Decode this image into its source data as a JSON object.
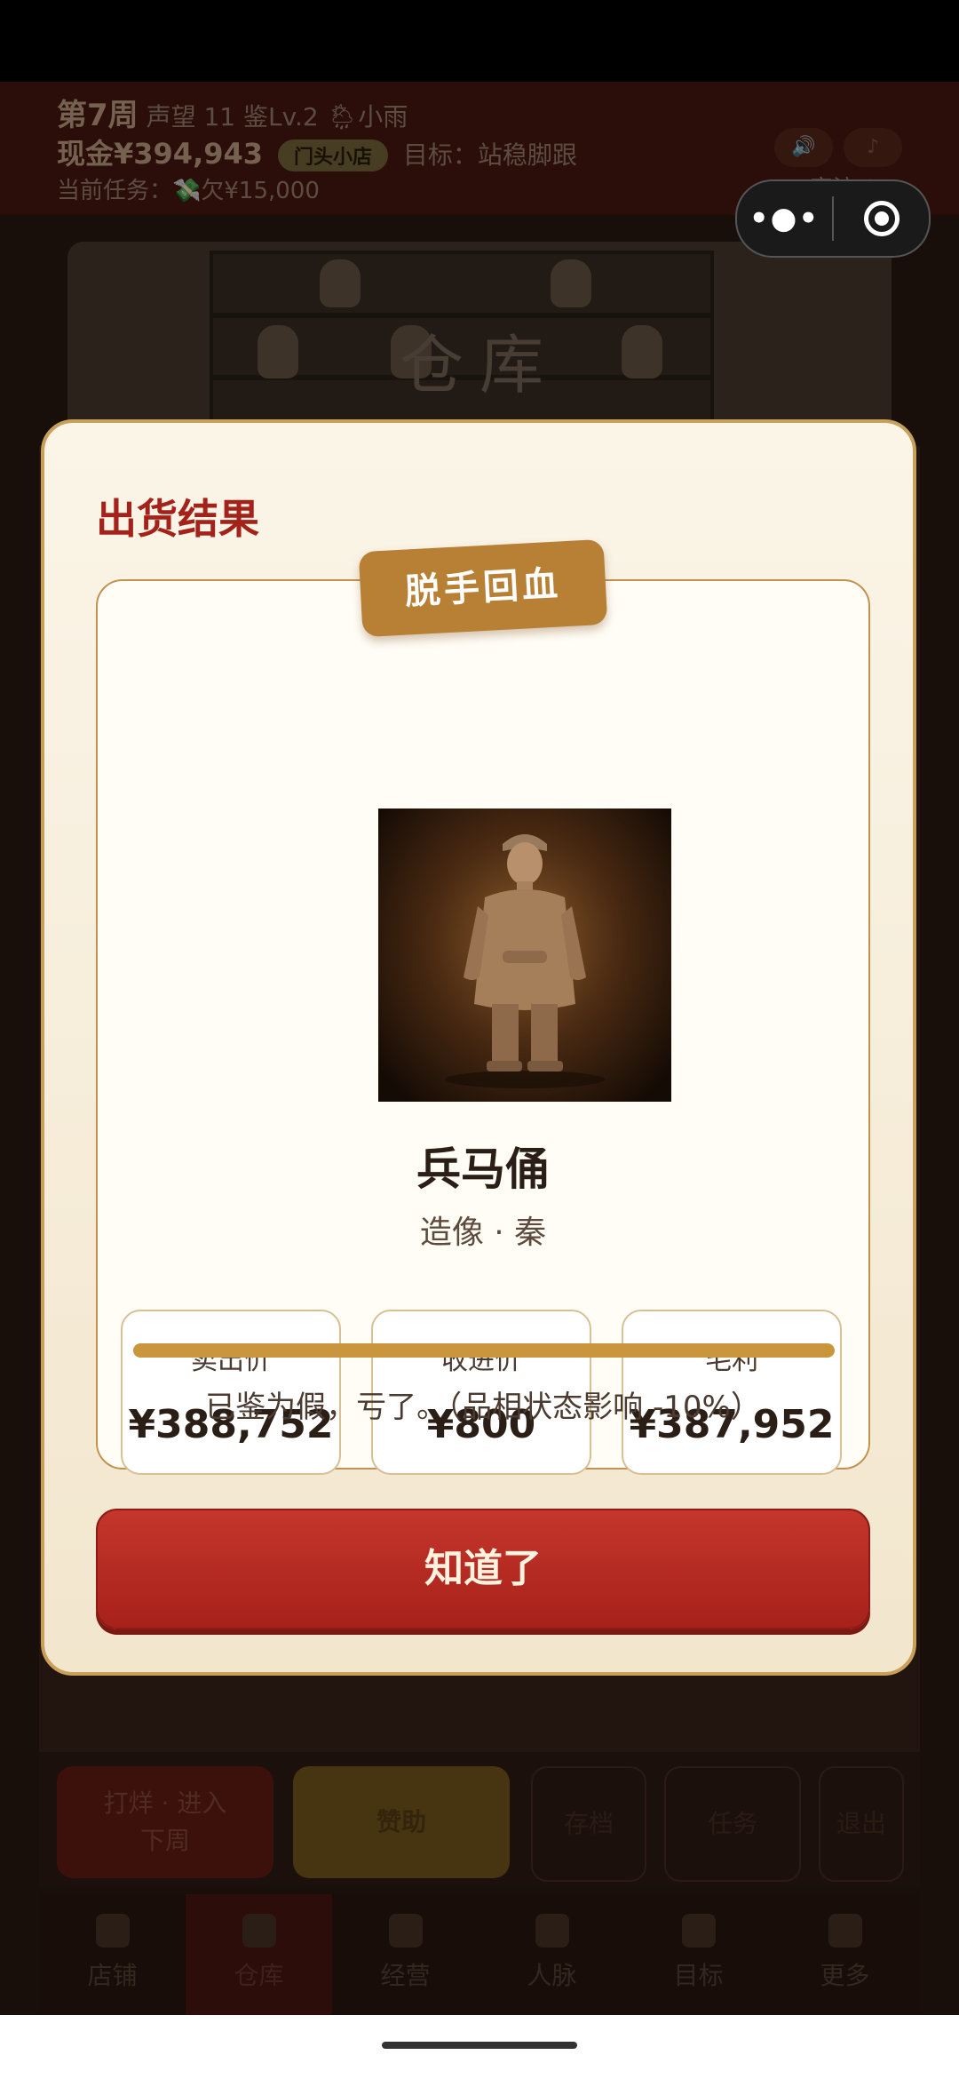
{
  "header": {
    "week": "第7周",
    "reputation": "声望 11",
    "appraisal_level": "鉴Lv.2",
    "weather": "🌦小雨",
    "cash": "现金¥394,943",
    "shop_badge": "门头小店",
    "goal": "目标：站稳脚跟",
    "current_task": "当前任务：💸欠¥15,000",
    "guests": "客流 0/5"
  },
  "warehouse": {
    "title": "仓库"
  },
  "bottom_actions": {
    "next_week": "打烊 · 进入下周",
    "sponsor": "赞助",
    "save": "存档",
    "tasks": "任务",
    "exit": "退出"
  },
  "tabs": [
    {
      "label": "店铺"
    },
    {
      "label": "仓库"
    },
    {
      "label": "经营"
    },
    {
      "label": "人脉"
    },
    {
      "label": "目标"
    },
    {
      "label": "更多"
    }
  ],
  "modal": {
    "title": "出货结果",
    "ribbon": "脱手回血",
    "item_name": "兵马俑",
    "category": "造像 · 秦",
    "stats": [
      {
        "label": "卖出价",
        "value": "¥388,752"
      },
      {
        "label": "收进价",
        "value": "¥800"
      },
      {
        "label": "毛利",
        "value": "¥387,952"
      }
    ],
    "progress": 1.0,
    "note": "已鉴为假，亏了。（品相状态影响 -10%）",
    "ok_label": "知道了"
  },
  "colors": {
    "accent_red": "#a3231b",
    "gold": "#c9963e"
  }
}
